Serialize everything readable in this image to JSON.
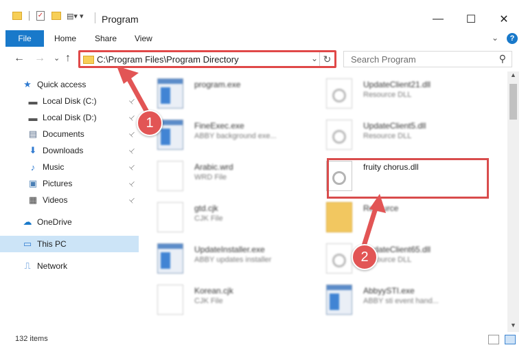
{
  "window": {
    "title": "Program",
    "minimize_glyph": "—",
    "maximize_glyph": "☐",
    "close_glyph": "✕"
  },
  "ribbon": {
    "file": "File",
    "home": "Home",
    "share": "Share",
    "view": "View",
    "help": "?",
    "collapse_glyph": "⌄"
  },
  "nav": {
    "back_glyph": "←",
    "forward_glyph": "→",
    "recent_glyph": "⌄",
    "up_glyph": "↑",
    "address": "C:\\Program Files\\Program Directory",
    "address_dropdown_glyph": "⌄",
    "refresh_glyph": "↻",
    "search_placeholder": "Search Program",
    "search_glyph": "⚲"
  },
  "sidebar": {
    "items": [
      {
        "label": "Quick access",
        "icon": "star-icon",
        "glyph": "★",
        "color": "#2f7ad0"
      },
      {
        "label": "Local Disk (C:)",
        "icon": "drive-icon",
        "glyph": "▬",
        "color": "#555555",
        "pinned": true
      },
      {
        "label": "Local Disk (D:)",
        "icon": "drive-icon",
        "glyph": "▬",
        "color": "#555555",
        "pinned": true
      },
      {
        "label": "Documents",
        "icon": "documents-icon",
        "glyph": "▤",
        "color": "#5a6f8c",
        "pinned": true
      },
      {
        "label": "Downloads",
        "icon": "download-icon",
        "glyph": "⬇",
        "color": "#2f7ad0",
        "pinned": true
      },
      {
        "label": "Music",
        "icon": "music-icon",
        "glyph": "♪",
        "color": "#2f7ad0",
        "pinned": true
      },
      {
        "label": "Pictures",
        "icon": "pictures-icon",
        "glyph": "▣",
        "color": "#4a7fb5",
        "pinned": true
      },
      {
        "label": "Videos",
        "icon": "video-icon",
        "glyph": "▦",
        "color": "#444444",
        "pinned": true
      },
      {
        "label": "OneDrive",
        "icon": "cloud-icon",
        "glyph": "☁",
        "color": "#1979ca"
      },
      {
        "label": "This PC",
        "icon": "computer-icon",
        "glyph": "▭",
        "color": "#2f7ad0",
        "selected": true
      },
      {
        "label": "Network",
        "icon": "network-icon",
        "glyph": "⎍",
        "color": "#2f7ad0"
      }
    ],
    "pin_glyph": "📌"
  },
  "files": [
    {
      "name": "program.exe",
      "desc": "",
      "kind": "exe-setup",
      "blurred": true
    },
    {
      "name": "UpdateClient21.dll",
      "desc": "Resource DLL",
      "kind": "dll",
      "blurred": true
    },
    {
      "name": "FineExec.exe",
      "desc": "ABBY background exe...",
      "kind": "exe",
      "blurred": true
    },
    {
      "name": "UpdateClient5.dll",
      "desc": "Resource DLL",
      "kind": "dll",
      "blurred": true
    },
    {
      "name": "Arabic.wrd",
      "desc": "WRD File",
      "kind": "doc",
      "blurred": true
    },
    {
      "name": "fruity chorus.dll",
      "desc": "",
      "kind": "dll",
      "blurred": false
    },
    {
      "name": "gtd.cjk",
      "desc": "CJK File",
      "kind": "doc",
      "blurred": true
    },
    {
      "name": "Resource",
      "desc": "",
      "kind": "folder",
      "blurred": true
    },
    {
      "name": "UpdateInstaller.exe",
      "desc": "ABBY updates installer",
      "kind": "exe",
      "blurred": true
    },
    {
      "name": "UpdateClient65.dll",
      "desc": "Resource DLL",
      "kind": "dll",
      "blurred": true
    },
    {
      "name": "Korean.cjk",
      "desc": "CJK File",
      "kind": "doc",
      "blurred": true
    },
    {
      "name": "AbbyySTI.exe",
      "desc": "ABBY sti event hand...",
      "kind": "exe",
      "blurred": true
    }
  ],
  "status": {
    "count": "132 items"
  },
  "annotations": {
    "step1": "1",
    "step2": "2",
    "color": "#e25555"
  }
}
